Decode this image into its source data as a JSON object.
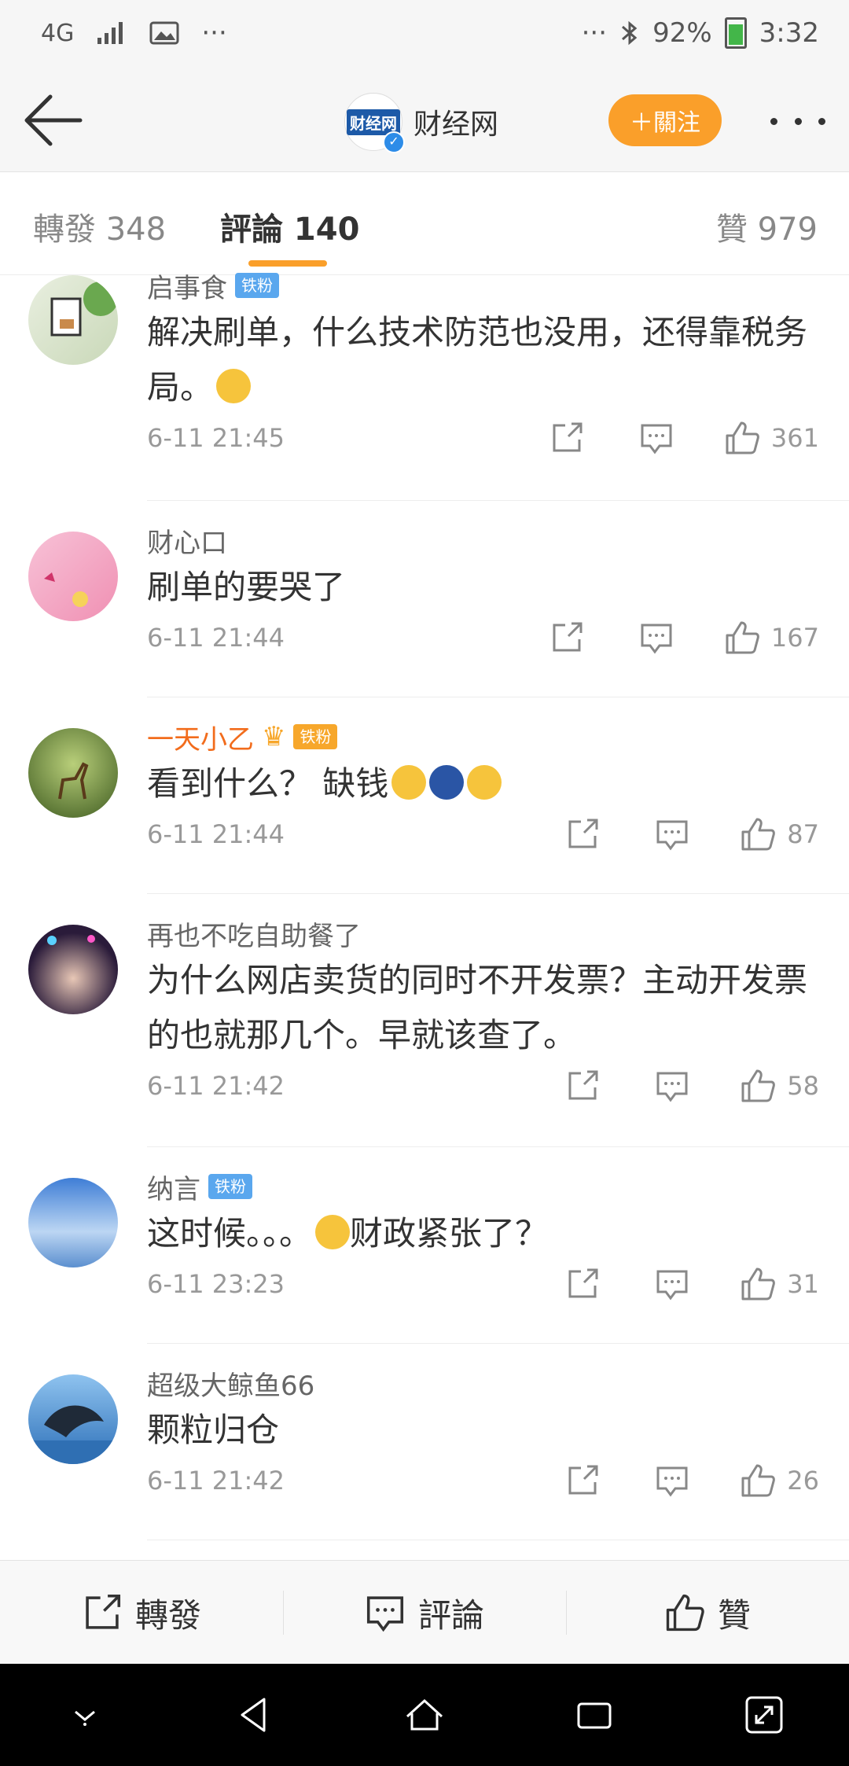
{
  "status_bar": {
    "network": "4G",
    "left_more": "···",
    "right_more": "···",
    "battery": "92%",
    "time": "3:32"
  },
  "nav": {
    "title": "财经网",
    "follow_label": "＋關注",
    "logo_text": "财经网"
  },
  "tabs": {
    "repost": "轉發 348",
    "comments": "評論 140",
    "likes": "贊 979"
  },
  "comments": [
    {
      "user": "启事食",
      "badge": "铁粉",
      "text": "解决刷单，什么技术防范也没用，还得靠税务局。",
      "time": "6-11 21:45",
      "likes": "361"
    },
    {
      "user": "财心口",
      "badge": "",
      "text": "刷单的要哭了",
      "time": "6-11 21:44",
      "likes": "167"
    },
    {
      "user": "一天小乙",
      "badge": "铁粉",
      "text": "看到什么？ 缺钱",
      "time": "6-11 21:44",
      "likes": "87"
    },
    {
      "user": "再也不吃自助餐了",
      "badge": "",
      "text": "为什么网店卖货的同时不开发票？主动开发票的也就那几个。早就该查了。",
      "time": "6-11 21:42",
      "likes": "58"
    },
    {
      "user": "纳言",
      "badge": "铁粉",
      "text_a": "这时候。。。",
      "text_b": "财政紧张了？",
      "time": "6-11 23:23",
      "likes": "31"
    },
    {
      "user": "超级大鲸鱼66",
      "badge": "",
      "text": "颗粒归仓",
      "time": "6-11 21:42",
      "likes": "26"
    }
  ],
  "bottom_bar": {
    "repost": "轉發",
    "comment": "評論",
    "like": "贊"
  },
  "colors": {
    "accent": "#fa9f2a",
    "badge_blue": "#5aa7ee",
    "orange_user": "#f26c1c"
  }
}
